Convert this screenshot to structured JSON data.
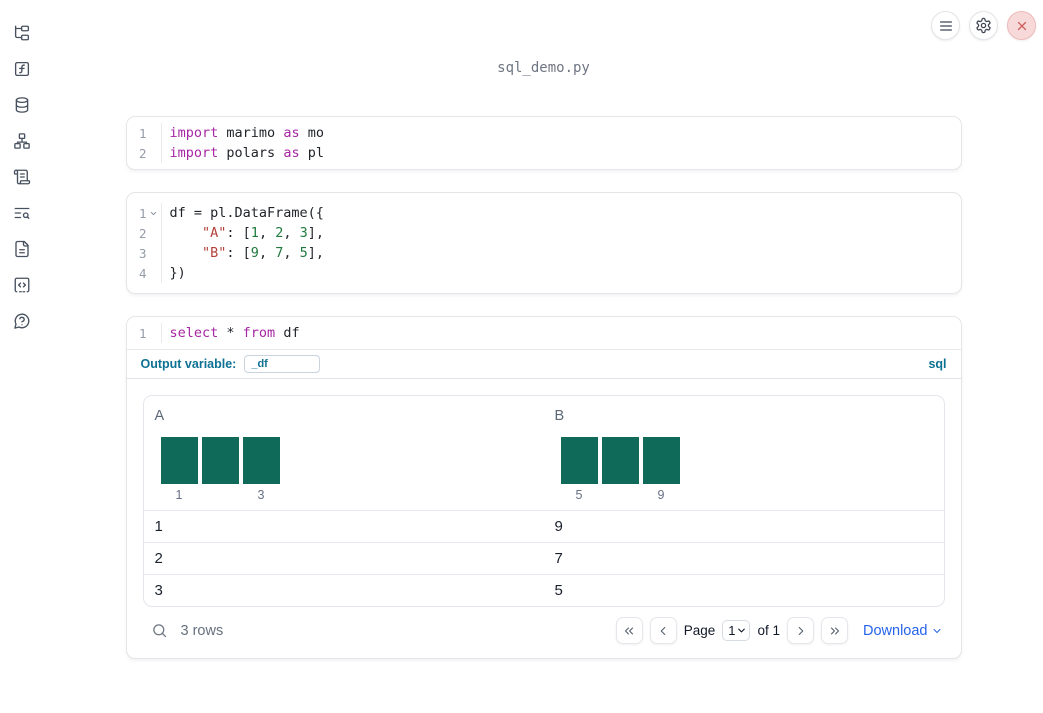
{
  "app": {
    "filename": "sql_demo.py"
  },
  "topbar": {
    "icons": [
      "hamburger-menu-icon",
      "gear-icon",
      "close-icon"
    ]
  },
  "sidebar": {
    "icons": [
      "file-tree-icon",
      "function-square-icon",
      "database-icon",
      "dependency-graph-icon",
      "scroll-text-icon",
      "text-search-icon",
      "document-icon",
      "snippets-icon",
      "help-icon"
    ]
  },
  "colors": {
    "histogram_bar": "#0f6a5a",
    "accent_teal": "#0c7193",
    "link_blue": "#2563eb",
    "keyword": "#a626a4",
    "string": "#b5403a",
    "number": "#1f7a3c"
  },
  "cells": [
    {
      "type": "code",
      "lines": [
        {
          "num": "1",
          "foldable": false,
          "tokens": [
            {
              "text": "import",
              "type": "kw"
            },
            {
              "text": " marimo ",
              "type": "plain"
            },
            {
              "text": "as",
              "type": "kw"
            },
            {
              "text": " mo",
              "type": "plain"
            }
          ]
        },
        {
          "num": "2",
          "foldable": false,
          "tokens": [
            {
              "text": "import",
              "type": "kw"
            },
            {
              "text": " polars ",
              "type": "plain"
            },
            {
              "text": "as",
              "type": "kw"
            },
            {
              "text": " pl",
              "type": "plain"
            }
          ]
        }
      ]
    },
    {
      "type": "code",
      "lines": [
        {
          "num": "1",
          "foldable": true,
          "tokens": [
            {
              "text": "df = pl.DataFrame({",
              "type": "plain"
            }
          ]
        },
        {
          "num": "2",
          "foldable": false,
          "tokens": [
            {
              "text": "    ",
              "type": "plain"
            },
            {
              "text": "\"A\"",
              "type": "str"
            },
            {
              "text": ": [",
              "type": "plain"
            },
            {
              "text": "1",
              "type": "num"
            },
            {
              "text": ", ",
              "type": "plain"
            },
            {
              "text": "2",
              "type": "num"
            },
            {
              "text": ", ",
              "type": "plain"
            },
            {
              "text": "3",
              "type": "num"
            },
            {
              "text": "],",
              "type": "plain"
            }
          ]
        },
        {
          "num": "3",
          "foldable": false,
          "tokens": [
            {
              "text": "    ",
              "type": "plain"
            },
            {
              "text": "\"B\"",
              "type": "str"
            },
            {
              "text": ": [",
              "type": "plain"
            },
            {
              "text": "9",
              "type": "num"
            },
            {
              "text": ", ",
              "type": "plain"
            },
            {
              "text": "7",
              "type": "num"
            },
            {
              "text": ", ",
              "type": "plain"
            },
            {
              "text": "5",
              "type": "num"
            },
            {
              "text": "],",
              "type": "plain"
            }
          ]
        },
        {
          "num": "4",
          "foldable": false,
          "tokens": [
            {
              "text": "})",
              "type": "plain"
            }
          ]
        }
      ]
    },
    {
      "type": "sql",
      "lines": [
        {
          "num": "1",
          "foldable": false,
          "tokens": [
            {
              "text": "select",
              "type": "kw"
            },
            {
              "text": " * ",
              "type": "plain"
            },
            {
              "text": "from",
              "type": "kw"
            },
            {
              "text": " df",
              "type": "plain"
            }
          ]
        }
      ],
      "output_variable_label": "Output variable:",
      "output_variable_value": "_df",
      "language_badge": "sql"
    }
  ],
  "table": {
    "columns": [
      {
        "name": "A",
        "histogram": {
          "bars": 3,
          "min_label": "1",
          "max_label": "3"
        }
      },
      {
        "name": "B",
        "histogram": {
          "bars": 3,
          "min_label": "5",
          "max_label": "9"
        }
      }
    ],
    "rows": [
      [
        "1",
        "9"
      ],
      [
        "2",
        "7"
      ],
      [
        "3",
        "5"
      ]
    ],
    "footer": {
      "row_count": "3 rows",
      "page_label": "Page",
      "page_value": "1",
      "of_label": "of 1",
      "download_label": "Download"
    }
  }
}
